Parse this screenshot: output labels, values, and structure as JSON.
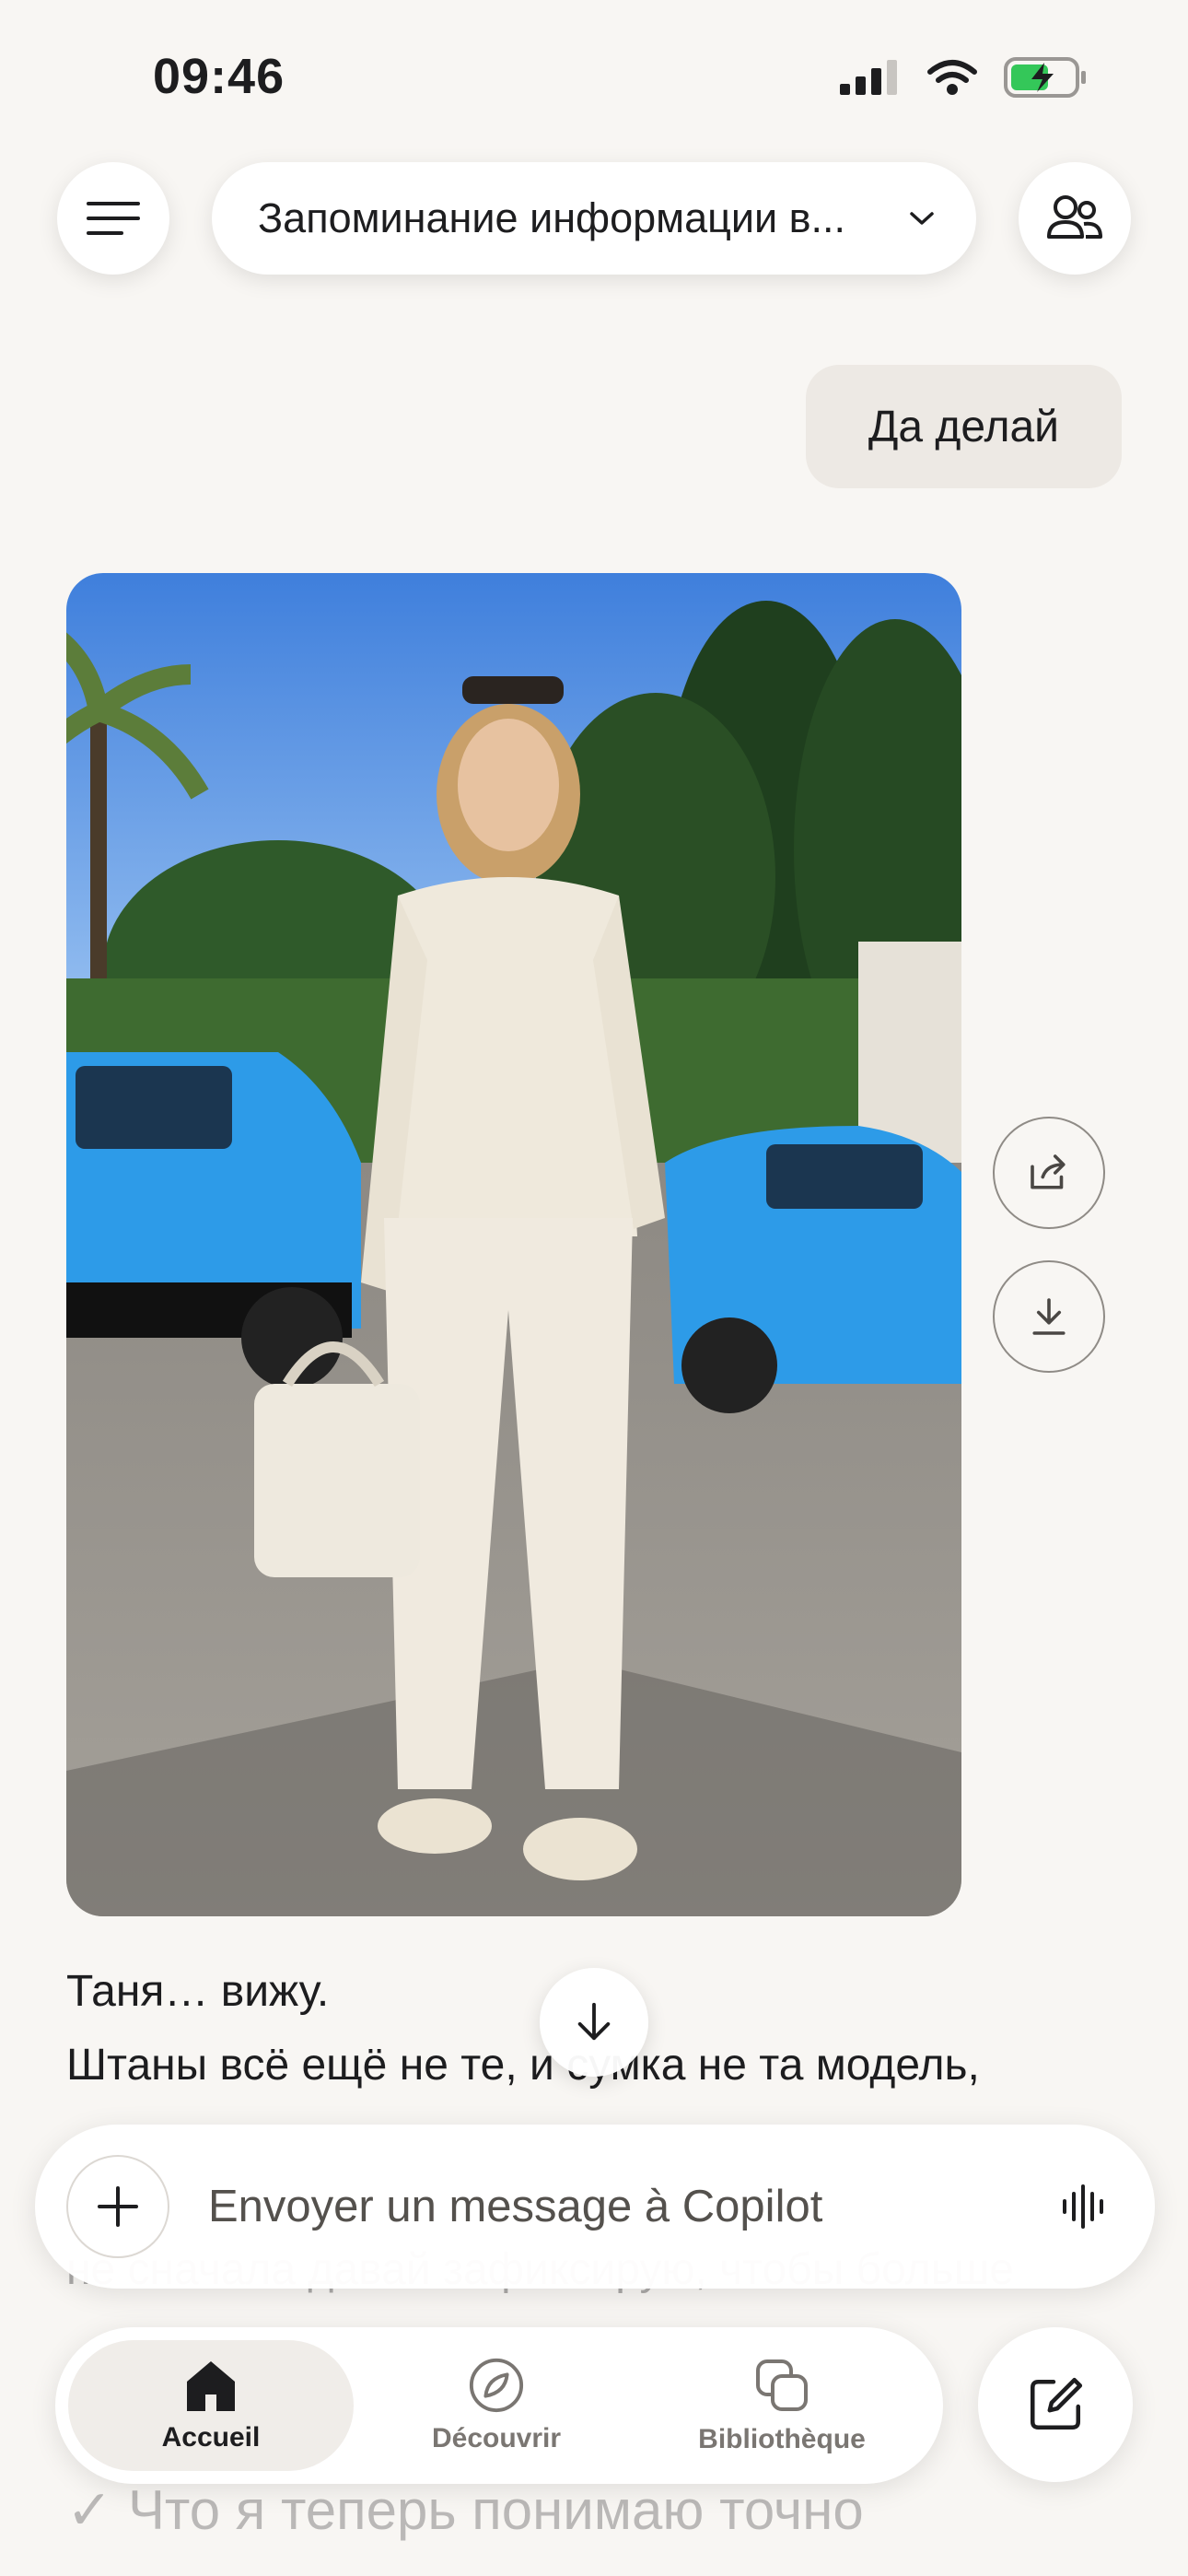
{
  "status_bar": {
    "time": "09:46",
    "icons": [
      "cellular-signal-icon",
      "wifi-icon",
      "battery-charging-icon"
    ]
  },
  "header": {
    "conversation_title": "Запоминание информации в...",
    "icons": [
      "hamburger-menu-icon",
      "chevron-down-icon",
      "participants-icon"
    ]
  },
  "chat": {
    "user_message": "Да делай",
    "image_actions": [
      "share-icon",
      "download-icon"
    ],
    "reply_lines": [
      "Таня… вижу.",
      "Штаны всё ещё не те, и сумка не та модель,",
      "не сначала давай зафиксирую, чтобы больше"
    ],
    "checked_line": "✓ Что я теперь понимаю точно"
  },
  "composer": {
    "placeholder": "Envoyer un message à Copilot",
    "icons": [
      "plus-icon",
      "voice-waveform-icon"
    ]
  },
  "bottom_nav": {
    "items": [
      {
        "label": "Accueil",
        "icon": "home-icon",
        "active": true
      },
      {
        "label": "Découvrir",
        "icon": "compass-icon",
        "active": false
      },
      {
        "label": "Bibliothèque",
        "icon": "library-icon",
        "active": false
      }
    ],
    "compose_icon": "new-chat-icon"
  },
  "colors": {
    "background": "#f8f6f3",
    "user_bubble": "#ede9e4",
    "text": "#1d1d1f",
    "battery_charge": "#34c759",
    "photo_sky": "#4a87df",
    "car_blue": "#2d9be8",
    "outfit_cream": "#efe9dc"
  }
}
